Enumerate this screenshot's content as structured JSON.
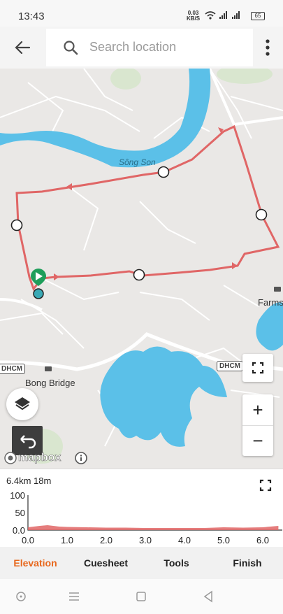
{
  "status_bar": {
    "time": "13:43",
    "net_speed": "0.03",
    "net_unit": "KB/S",
    "icons": "wifi, signal, signal",
    "battery": "65"
  },
  "header": {
    "back_icon": "arrow-left-icon",
    "search_icon": "search-icon",
    "search_placeholder": "Search location",
    "more_icon": "more-vertical-icon"
  },
  "map": {
    "labels": {
      "river": "Sông Son",
      "farms": "Farms",
      "bong_bridge": "Bong Bridge",
      "dhcm_left": "DHCM",
      "dhcm_right": "DHCM",
      "attribution": "mapbox"
    },
    "route_color": "#e06666",
    "water_color": "#5bc0e8",
    "start_marker_color": "#1e9e5a",
    "controls": {
      "fullscreen_icon": "fullscreen-icon",
      "zoom_in": "+",
      "zoom_out": "−",
      "layers_icon": "layers-icon",
      "undo_icon": "undo-icon",
      "info_icon": "info-icon"
    }
  },
  "elevation": {
    "summary": "6.4km 18m",
    "expand_icon": "fullscreen-icon",
    "chart_data": {
      "type": "area",
      "x": [
        0.0,
        0.3,
        0.5,
        0.8,
        1.0,
        1.5,
        2.0,
        2.5,
        3.0,
        3.5,
        4.0,
        4.5,
        5.0,
        5.5,
        6.0,
        6.4
      ],
      "y": [
        8,
        12,
        14,
        10,
        9,
        8,
        7,
        7,
        6,
        6,
        6,
        6,
        8,
        7,
        8,
        12
      ],
      "ylim": [
        0,
        100
      ],
      "xlim": [
        0,
        6.5
      ],
      "y_ticks": [
        "100",
        "50",
        "0.0"
      ],
      "x_ticks": [
        "0.0",
        "1.0",
        "2.0",
        "3.0",
        "4.0",
        "5.0",
        "6.0"
      ],
      "fill_color": "#e06666"
    }
  },
  "tabs": [
    {
      "label": "Elevation",
      "active": true
    },
    {
      "label": "Cuesheet",
      "active": false
    },
    {
      "label": "Tools",
      "active": false
    },
    {
      "label": "Finish",
      "active": false
    }
  ],
  "nav_bar": {
    "icons": [
      "circle-nav-icon",
      "menu-nav-icon",
      "home-square-icon",
      "back-triangle-icon"
    ]
  }
}
